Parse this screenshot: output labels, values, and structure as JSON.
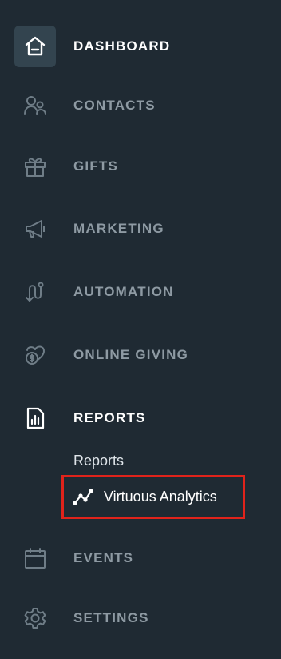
{
  "sidebar": {
    "items": [
      {
        "label": "DASHBOARD",
        "icon": "home-icon"
      },
      {
        "label": "CONTACTS",
        "icon": "contacts-icon"
      },
      {
        "label": "GIFTS",
        "icon": "gift-icon"
      },
      {
        "label": "MARKETING",
        "icon": "megaphone-icon"
      },
      {
        "label": "AUTOMATION",
        "icon": "automation-icon"
      },
      {
        "label": "ONLINE GIVING",
        "icon": "donation-icon"
      },
      {
        "label": "REPORTS",
        "icon": "reports-icon"
      },
      {
        "label": "EVENTS",
        "icon": "calendar-icon"
      },
      {
        "label": "SETTINGS",
        "icon": "gear-icon"
      }
    ],
    "reports_submenu": {
      "reports_label": "Reports",
      "analytics_label": "Virtuous Analytics",
      "analytics_icon": "line-chart-icon"
    },
    "colors": {
      "background": "#1f2a33",
      "active_icon_bg": "#33444f",
      "muted_text": "#8e9aa3",
      "highlight_border": "#e0231b"
    }
  }
}
